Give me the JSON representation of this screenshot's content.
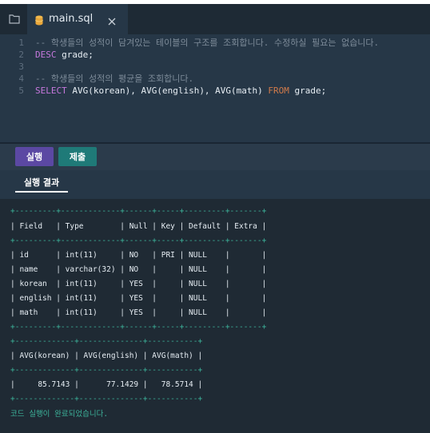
{
  "tab": {
    "filename": "main.sql"
  },
  "editor": {
    "lines": [
      {
        "no": "1",
        "tokens": [
          {
            "t": "-- 학생들의 성적이 담겨있는 테이블의 구조를 조회합니다. 수정하실 필요는 없습니다.",
            "c": "comment"
          }
        ]
      },
      {
        "no": "2",
        "tokens": [
          {
            "t": "DESC",
            "c": "kw"
          },
          {
            "t": " grade;",
            "c": "plain"
          }
        ]
      },
      {
        "no": "3",
        "tokens": [
          {
            "t": "",
            "c": "plain"
          }
        ]
      },
      {
        "no": "4",
        "tokens": [
          {
            "t": "-- 학생들의 성적의 평균을 조회합니다.",
            "c": "comment"
          }
        ]
      },
      {
        "no": "5",
        "tokens": [
          {
            "t": "SELECT",
            "c": "kw"
          },
          {
            "t": " AVG(korean), AVG(english), AVG(math) ",
            "c": "plain"
          },
          {
            "t": "FROM",
            "c": "kw2"
          },
          {
            "t": " grade;",
            "c": "plain"
          }
        ]
      }
    ]
  },
  "buttons": {
    "run": "실행",
    "submit": "제출"
  },
  "results": {
    "tab_label": "실행 결과",
    "output": [
      "+---------+-------------+------+-----+---------+-------+",
      "| Field   | Type        | Null | Key | Default | Extra |",
      "+---------+-------------+------+-----+---------+-------+",
      "| id      | int(11)     | NO   | PRI | NULL    |       |",
      "| name    | varchar(32) | NO   |     | NULL    |       |",
      "| korean  | int(11)     | YES  |     | NULL    |       |",
      "| english | int(11)     | YES  |     | NULL    |       |",
      "| math    | int(11)     | YES  |     | NULL    |       |",
      "+---------+-------------+------+-----+---------+-------+",
      "+-------------+--------------+-----------+",
      "| AVG(korean) | AVG(english) | AVG(math) |",
      "+-------------+--------------+-----------+",
      "|     85.7143 |      77.1429 |   78.5714 |",
      "+-------------+--------------+-----------+"
    ],
    "status": "코드 실행이 완료되었습니다."
  }
}
